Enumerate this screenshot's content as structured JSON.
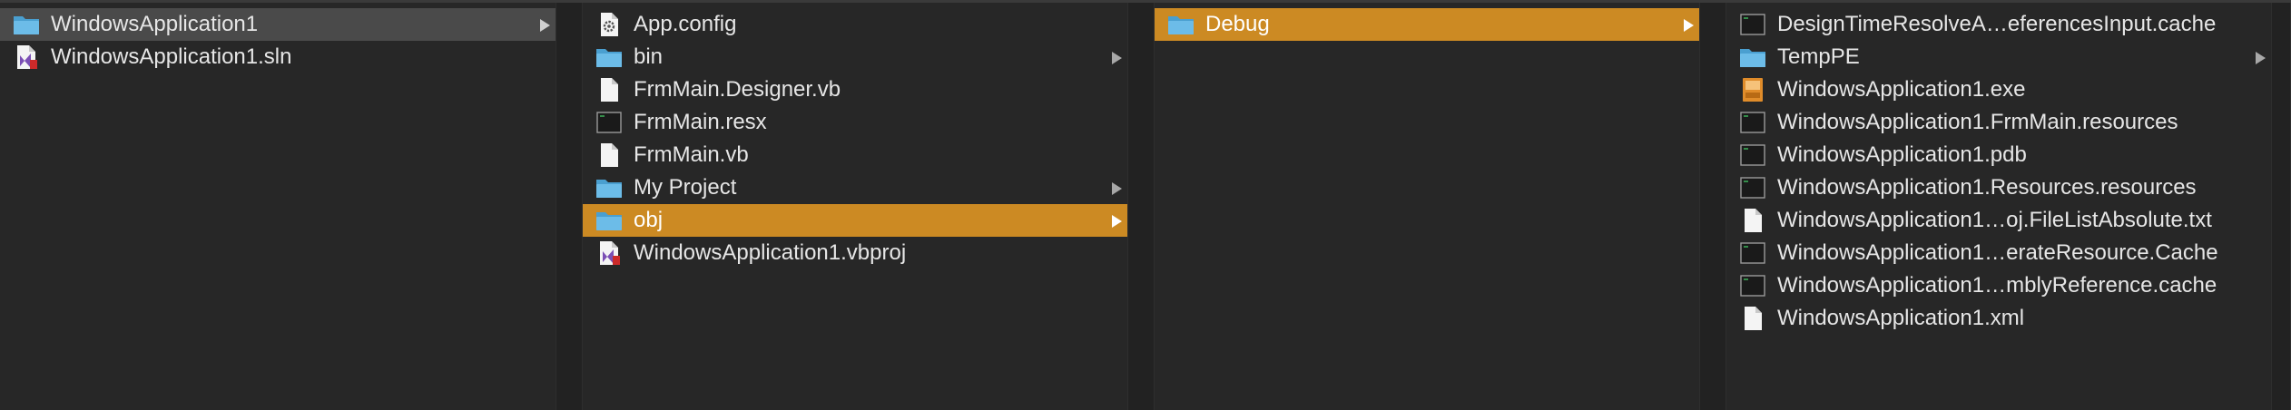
{
  "columns": [
    {
      "items": [
        {
          "label": "WindowsApplication1",
          "icon": "folder-icon",
          "has_children": true,
          "selected": "gray"
        },
        {
          "label": "WindowsApplication1.sln",
          "icon": "visual-studio-solution-icon",
          "has_children": false,
          "selected": "none"
        }
      ]
    },
    {
      "items": [
        {
          "label": "App.config",
          "icon": "config-file-icon",
          "has_children": false,
          "selected": "none"
        },
        {
          "label": "bin",
          "icon": "folder-icon",
          "has_children": true,
          "selected": "none"
        },
        {
          "label": "FrmMain.Designer.vb",
          "icon": "document-icon",
          "has_children": false,
          "selected": "none"
        },
        {
          "label": "FrmMain.resx",
          "icon": "terminal-file-icon",
          "has_children": false,
          "selected": "none"
        },
        {
          "label": "FrmMain.vb",
          "icon": "document-icon",
          "has_children": false,
          "selected": "none"
        },
        {
          "label": "My Project",
          "icon": "folder-icon",
          "has_children": true,
          "selected": "none"
        },
        {
          "label": "obj",
          "icon": "folder-icon",
          "has_children": true,
          "selected": "orange"
        },
        {
          "label": "WindowsApplication1.vbproj",
          "icon": "visual-studio-project-icon",
          "has_children": false,
          "selected": "none"
        }
      ]
    },
    {
      "items": [
        {
          "label": "Debug",
          "icon": "folder-icon",
          "has_children": true,
          "selected": "orange"
        }
      ]
    },
    {
      "items": [
        {
          "label": "DesignTimeResolveA…eferencesInput.cache",
          "icon": "terminal-file-icon",
          "has_children": false,
          "selected": "none"
        },
        {
          "label": "TempPE",
          "icon": "folder-icon",
          "has_children": true,
          "selected": "none"
        },
        {
          "label": "WindowsApplication1.exe",
          "icon": "executable-icon",
          "has_children": false,
          "selected": "none"
        },
        {
          "label": "WindowsApplication1.FrmMain.resources",
          "icon": "terminal-file-icon",
          "has_children": false,
          "selected": "none"
        },
        {
          "label": "WindowsApplication1.pdb",
          "icon": "terminal-file-icon",
          "has_children": false,
          "selected": "none"
        },
        {
          "label": "WindowsApplication1.Resources.resources",
          "icon": "terminal-file-icon",
          "has_children": false,
          "selected": "none"
        },
        {
          "label": "WindowsApplication1…oj.FileListAbsolute.txt",
          "icon": "document-icon",
          "has_children": false,
          "selected": "none"
        },
        {
          "label": "WindowsApplication1…erateResource.Cache",
          "icon": "terminal-file-icon",
          "has_children": false,
          "selected": "none"
        },
        {
          "label": "WindowsApplication1…mblyReference.cache",
          "icon": "terminal-file-icon",
          "has_children": false,
          "selected": "none"
        },
        {
          "label": "WindowsApplication1.xml",
          "icon": "document-icon",
          "has_children": false,
          "selected": "none"
        }
      ]
    }
  ],
  "colors": {
    "background": "#272727",
    "selection_active": "#cc8a23",
    "selection_inactive": "#4a4a4a",
    "text": "#e6e6e6",
    "folder": "#5fb2e0"
  }
}
